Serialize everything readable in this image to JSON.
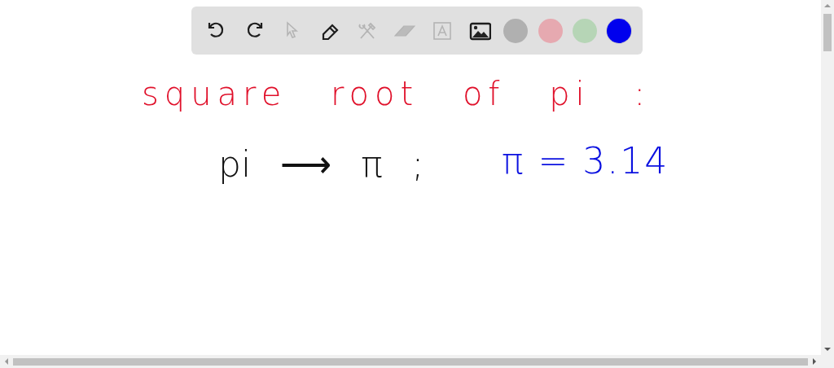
{
  "toolbar": {
    "tools": [
      {
        "kind": "undo",
        "disabled": false
      },
      {
        "kind": "redo",
        "disabled": false
      },
      {
        "kind": "select",
        "disabled": true
      },
      {
        "kind": "pen",
        "disabled": false
      },
      {
        "kind": "shapes",
        "disabled": true
      },
      {
        "kind": "eraser",
        "disabled": true
      },
      {
        "kind": "text",
        "disabled": true
      },
      {
        "kind": "image",
        "disabled": false
      }
    ],
    "colors": [
      {
        "color": "#b0b0b0",
        "selected": false
      },
      {
        "color": "#e6a9b0",
        "selected": false
      },
      {
        "color": "#b6d5b6",
        "selected": false
      },
      {
        "color": "#0000ee",
        "selected": true
      }
    ]
  },
  "canvas": {
    "ink": [
      {
        "text": "square root of pi :",
        "color": "#e0102a",
        "kind": "heading"
      },
      {
        "text": "pi ⟶ π ;",
        "color": "#111111",
        "kind": "left"
      },
      {
        "text": "π = 3.14",
        "color": "#0a10e0",
        "kind": "right"
      }
    ]
  }
}
